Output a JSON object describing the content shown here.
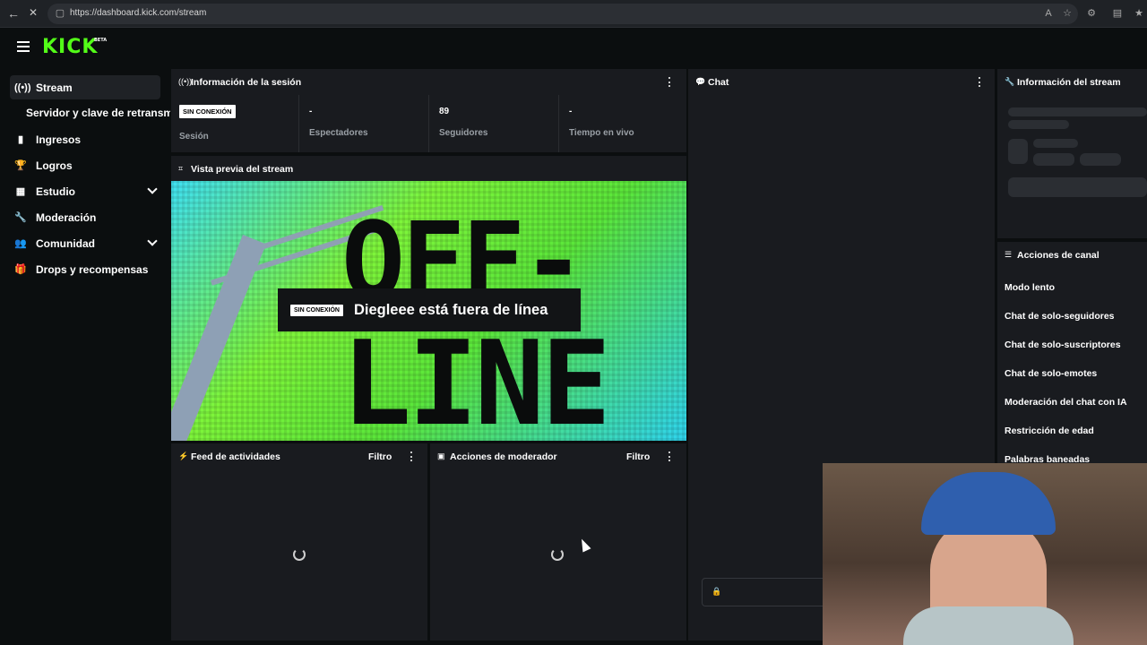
{
  "browser": {
    "url": "https://dashboard.kick.com/stream"
  },
  "topbar": {
    "logo": "KICK",
    "logo_tag": "BETA"
  },
  "sidebar": {
    "items": [
      {
        "label": "Stream",
        "icon": "broadcast-icon"
      },
      {
        "label": "Servidor y clave de retransmisión",
        "icon": ""
      },
      {
        "label": "Ingresos",
        "icon": "bar-chart-icon"
      },
      {
        "label": "Logros",
        "icon": "trophy-icon"
      },
      {
        "label": "Estudio",
        "icon": "layout-icon"
      },
      {
        "label": "Moderación",
        "icon": "wrench-icon"
      },
      {
        "label": "Comunidad",
        "icon": "people-icon"
      },
      {
        "label": "Drops y recompensas",
        "icon": "gift-icon"
      }
    ]
  },
  "session": {
    "title": "Información de la sesión",
    "badge": "SIN CONEXIÓN",
    "session_label": "Sesión",
    "stats": [
      {
        "value": "-",
        "label": "Espectadores"
      },
      {
        "value": "89",
        "label": "Seguidores"
      },
      {
        "value": "-",
        "label": "Tiempo en vivo"
      }
    ]
  },
  "preview": {
    "title": "Vista previa del stream",
    "word_top": "OFF-",
    "word_bottom": "LINE",
    "badge": "SIN CONEXIÓN",
    "message": "Diegleee está fuera de línea"
  },
  "activity": {
    "title": "Feed de actividades",
    "filter": "Filtro"
  },
  "mod_actions": {
    "title": "Acciones de moderador",
    "filter": "Filtro"
  },
  "chat": {
    "title": "Chat"
  },
  "stream_info": {
    "title": "Información del stream"
  },
  "channel_actions": {
    "title": "Acciones de canal",
    "items": [
      "Modo lento",
      "Chat de solo-seguidores",
      "Chat de solo-suscriptores",
      "Chat de solo-emotes",
      "Moderación del chat con IA",
      "Restricción de edad",
      "Palabras baneadas"
    ]
  },
  "colors": {
    "brand": "#53fc18",
    "panel": "#191b1f",
    "background": "#0b0e0f"
  }
}
